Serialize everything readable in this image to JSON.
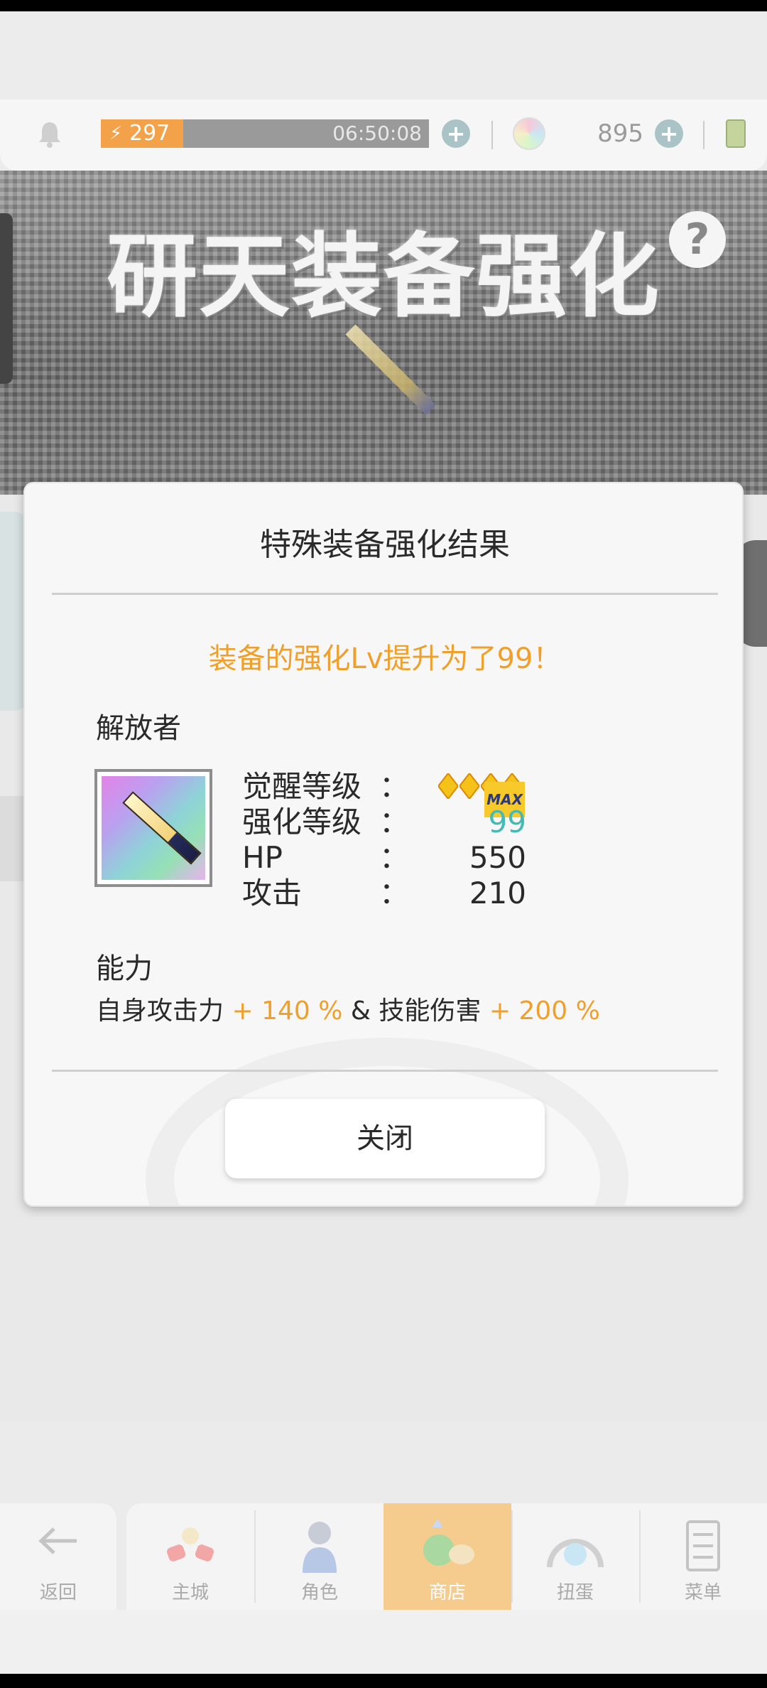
{
  "topbar": {
    "stamina_value": "297",
    "stamina_fraction": 0.25,
    "stamina_timer": "06:50:08",
    "gem_count": "895"
  },
  "banner": {
    "title": "研天装备强化",
    "help_symbol": "?"
  },
  "modal": {
    "title": "特殊装备强化结果",
    "result_message": "装备的强化Lv提升为了99！",
    "category_label": "解放者",
    "stats": [
      {
        "name": "觉醒等级",
        "colon": "：",
        "value": ""
      },
      {
        "name": "强化等级",
        "colon": "：",
        "value": "99"
      },
      {
        "name": "HP",
        "colon": "：",
        "value": "550"
      },
      {
        "name": "攻击",
        "colon": "：",
        "value": "210"
      }
    ],
    "awaken_max_label": "MAX",
    "ability_label": "能力",
    "ability": {
      "part1": "自身攻击力",
      "value1": " + 140 %",
      "connector": " & ",
      "part2": "技能伤害",
      "value2": " + 200 %"
    },
    "close_label": "关闭"
  },
  "nav": {
    "back_label": "返回",
    "items": [
      {
        "label": "主城",
        "icon": "castle-icon"
      },
      {
        "label": "角色",
        "icon": "character-icon"
      },
      {
        "label": "商店",
        "icon": "shop-icon",
        "active": true
      },
      {
        "label": "扭蛋",
        "icon": "gacha-icon"
      },
      {
        "label": "菜单",
        "icon": "menu-icon"
      }
    ]
  },
  "colors": {
    "accent_orange": "#f0a02a",
    "teal_value": "#44b9b5",
    "active_tab": "#f6cc8e"
  }
}
